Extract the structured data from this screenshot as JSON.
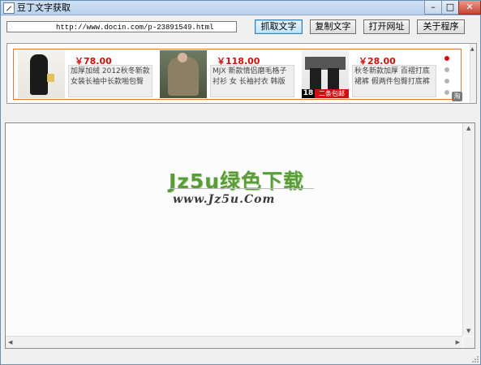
{
  "window": {
    "title": "豆丁文字获取",
    "controls": {
      "minimize": "–",
      "maximize": "□",
      "close": "✕"
    }
  },
  "toolbar": {
    "url_value": "http://www.docin.com/p-23891549.html",
    "grab_label": "抓取文字",
    "copy_label": "复制文字",
    "open_label": "打开网址",
    "about_label": "关于程序"
  },
  "banner": {
    "products": [
      {
        "price": "￥78.00",
        "description": "加厚加绒 2012秋冬新款 女装长袖中长款啪包臀",
        "icon": "black-dress-photo"
      },
      {
        "price": "￥118.00",
        "description": "MJX 新款情侣磨毛格子 衬衫 女 长袖衬衣 韩版",
        "icon": "plaid-shirt-photo"
      },
      {
        "price": "￥28.00",
        "description": "秋冬新款加厚 百褶打底 裙裤 假两件包臀打底裤",
        "icon": "skirt-leggings-photo",
        "badge_number": "18",
        "badge_text": "二条包邮"
      }
    ],
    "active_dot": 0,
    "dot_count": 4,
    "corner_icon_text": "淘"
  },
  "content": {
    "watermark_main": "Jz5u绿色下载",
    "watermark_sub": "www.Jz5u.Com"
  },
  "colors": {
    "accent": "#d10f0f",
    "banner_border": "#e07a3c",
    "watermark_green": "#5a9c3a"
  }
}
